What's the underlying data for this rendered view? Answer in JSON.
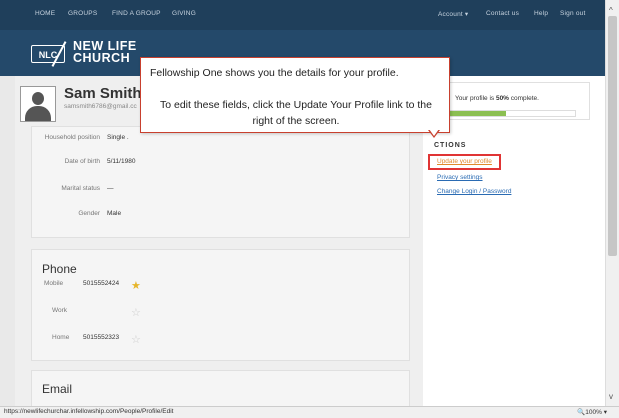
{
  "nav": {
    "items": [
      "HOME",
      "GROUPS",
      "FIND A GROUP",
      "GIVING"
    ],
    "right_items": [
      "Account ▾",
      "Contact us",
      "Help",
      "Sign out"
    ]
  },
  "logo": {
    "abbr": "NLC",
    "line1": "NEW LIFE",
    "line2": "CHURCH"
  },
  "profile": {
    "name": "Sam Smith",
    "email": "samsmith6786@gmail.cc",
    "fields": [
      {
        "label": "Household position",
        "value": "Single ."
      },
      {
        "label": "Date of birth",
        "value": "5/11/1980"
      },
      {
        "label": "Marital status",
        "value": "—"
      },
      {
        "label": "Gender",
        "value": "Male"
      }
    ]
  },
  "phone": {
    "title": "Phone",
    "items": [
      {
        "label": "Mobile",
        "value": "5015552424",
        "star": "★",
        "starred": true
      },
      {
        "label": "Work",
        "value": "",
        "star": "☆",
        "starred": false
      },
      {
        "label": "Home",
        "value": "5015552323",
        "star": "☆",
        "starred": false
      }
    ]
  },
  "email_section": {
    "title": "Email"
  },
  "progress": {
    "prefix": "Your profile is ",
    "percent_label": "50%",
    "suffix": " complete.",
    "value": 0.5,
    "color": "#8bbf51"
  },
  "actions": {
    "title": "CTIONS",
    "links": [
      "Update your profile",
      "Privacy settings",
      "Change Login / Password"
    ]
  },
  "callout": {
    "line1": "Fellowship One shows you the details for your profile.",
    "line2": "To edit these fields, click the Update Your Profile link to the right of the screen."
  },
  "status": {
    "url": "https://newlifechurchar.infellowship.com/People/Profile/Edit",
    "zoom": "🔍100%  ▾"
  },
  "colors": {
    "nav": "#1f3f5b",
    "header": "#24496a",
    "link": "#2a6bb3",
    "highlight": "#e03434"
  }
}
